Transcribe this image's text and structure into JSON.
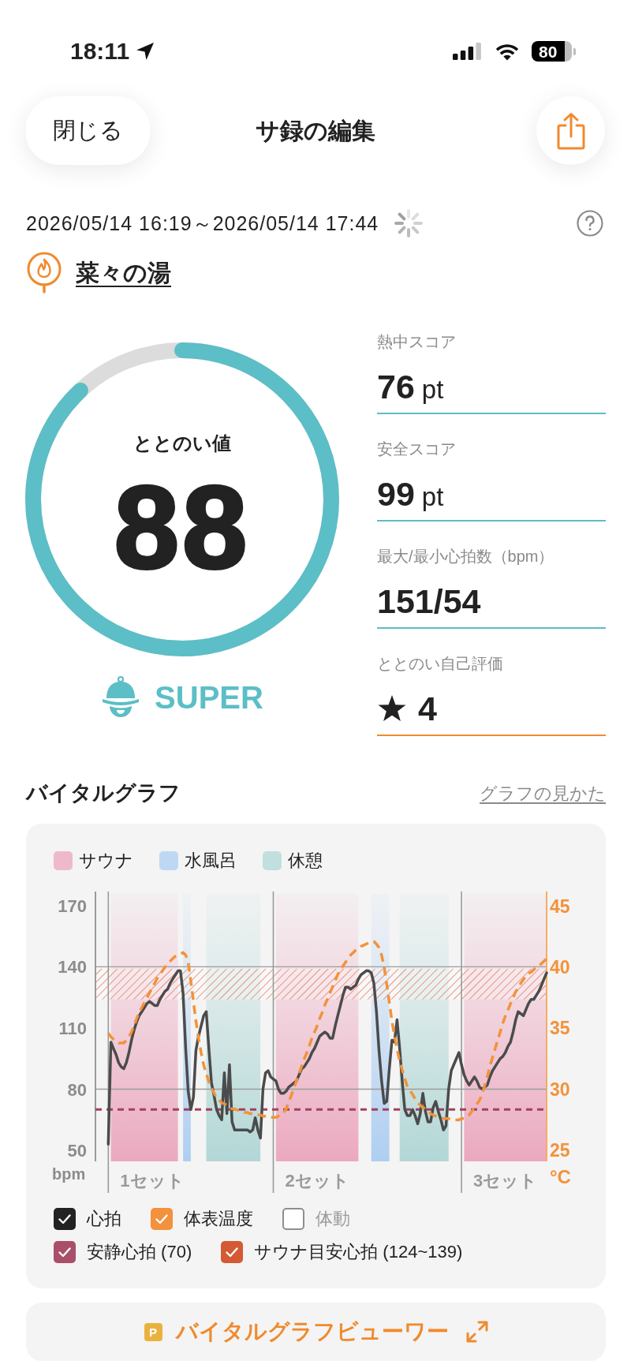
{
  "status_bar": {
    "time": "18:11",
    "battery": "80"
  },
  "header": {
    "close_button": "閉じる",
    "title": "サ録の編集"
  },
  "session": {
    "period": "2026/05/14 16:19～2026/05/14 17:44",
    "loading": true,
    "facility": "菜々の湯"
  },
  "score": {
    "label": "ととのい値",
    "value": "88",
    "level": 0.88,
    "rank": "SUPER"
  },
  "stats": [
    {
      "kind": "number",
      "label": "熱中スコア",
      "value": "76",
      "unit": "pt",
      "color": "#5cbec6"
    },
    {
      "kind": "number",
      "label": "安全スコア",
      "value": "99",
      "unit": "pt",
      "color": "#5cbec6"
    },
    {
      "kind": "number",
      "label": "最大/最小心拍数（bpm）",
      "value": "151/54",
      "color": "#5cbec6"
    },
    {
      "kind": "rating",
      "label": "ととのい自己評価",
      "value": "4",
      "color": "#f08a2e"
    }
  ],
  "vital_graph": {
    "title": "バイタルグラフ",
    "help_link": "グラフの見かた",
    "legend": [
      {
        "label": "サウナ",
        "color": "#efb9cc"
      },
      {
        "label": "水風呂",
        "color": "#bed8f4"
      },
      {
        "label": "休憩",
        "color": "#c1dfde"
      }
    ],
    "chart_data": {
      "type": "line",
      "ylabel": "bpm",
      "y2label": "°C",
      "ylim": [
        44.6,
        176.9
      ],
      "y2lim": [
        24.1,
        46.2
      ],
      "yticks": [
        50,
        80,
        110,
        140,
        170
      ],
      "y2ticks": [
        25,
        30,
        35,
        40,
        45
      ],
      "categories": [
        null,
        null,
        null,
        null,
        null,
        null,
        null,
        null,
        null,
        null,
        null,
        null,
        null,
        null,
        null,
        null,
        null,
        null,
        null,
        null,
        null,
        null,
        null,
        null,
        null,
        null,
        null,
        null,
        null,
        null,
        null,
        null,
        null,
        null,
        null,
        null,
        null,
        null,
        null,
        null,
        null,
        null,
        null,
        null,
        null,
        null,
        null,
        null,
        null,
        null,
        null,
        null,
        null,
        null,
        null,
        null,
        null,
        null,
        null,
        null,
        null,
        null,
        null,
        null,
        null,
        null,
        null,
        null,
        null,
        null,
        null,
        null,
        null,
        null,
        null,
        null,
        null,
        null,
        null,
        null,
        null,
        null,
        null,
        null,
        null,
        null,
        null,
        null,
        null,
        null,
        null,
        null,
        null,
        null,
        null,
        null,
        null,
        null,
        null,
        null,
        null,
        null,
        null,
        null,
        null,
        null,
        null,
        null,
        null,
        null,
        null,
        null,
        null,
        null,
        null,
        null,
        null,
        null,
        null,
        null,
        null,
        null,
        null,
        null,
        null,
        null,
        null,
        null,
        null,
        null,
        null,
        null,
        null,
        null,
        null,
        null,
        null,
        null,
        null,
        null,
        null,
        null,
        null,
        null,
        null,
        null,
        null,
        null,
        null,
        null,
        null,
        null,
        null,
        null,
        null,
        null,
        null,
        null,
        null,
        null,
        null,
        null,
        null,
        null,
        null,
        null,
        null,
        null,
        null,
        null,
        null
      ],
      "series": [
        {
          "color": "#4b4b4b",
          "line_style": "solid",
          "values": [
            53,
            103,
            100,
            97,
            93,
            91,
            90,
            93,
            98,
            104,
            109,
            113,
            116,
            118,
            120,
            122,
            123,
            122,
            121,
            121,
            124,
            126,
            128,
            129,
            132,
            134,
            136,
            138,
            138,
            127,
            100,
            79,
            70,
            76,
            99,
            106,
            111,
            116,
            118,
            100,
            83,
            77,
            70,
            67,
            65,
            88,
            68,
            92,
            64,
            60,
            60,
            60,
            60,
            60,
            60,
            59,
            60,
            66,
            60,
            56,
            80,
            88,
            89,
            86,
            85,
            84,
            80,
            78,
            78,
            79,
            81,
            82,
            83,
            84,
            87,
            90,
            91,
            93,
            95,
            98,
            100,
            103,
            106,
            107,
            108,
            107,
            105,
            105,
            111,
            116,
            121,
            126,
            130,
            130,
            129,
            130,
            131,
            134,
            136,
            137,
            138,
            138,
            137,
            132,
            118,
            99,
            84,
            73,
            74,
            90,
            104,
            103,
            114,
            100,
            84,
            70,
            67,
            67,
            70,
            67,
            63,
            68,
            78,
            69,
            64,
            64,
            71,
            74,
            69,
            65,
            60,
            62,
            80,
            89,
            92,
            95,
            98,
            92,
            87,
            84,
            82,
            84,
            86,
            84,
            81,
            80,
            81,
            82,
            86,
            89,
            91,
            93,
            95,
            96,
            98,
            101,
            103,
            108,
            114,
            118,
            117,
            116,
            119,
            122,
            124,
            124,
            126,
            128,
            131,
            134,
            137
          ]
        },
        {
          "color": "#f3923a",
          "axis": "y2",
          "line_style": "dashed",
          "values": [
            34.6,
            34.3,
            34.1,
            33.9,
            33.8,
            33.8,
            33.8,
            34.0,
            34.3,
            34.7,
            35.2,
            35.8,
            36.3,
            36.7,
            37.1,
            37.5,
            37.9,
            38.3,
            38.7,
            39.1,
            39.4,
            39.7,
            40.0,
            40.3,
            40.5,
            40.7,
            40.9,
            41.0,
            41.1,
            41.2,
            41.0,
            40.4,
            38.9,
            37.2,
            35.6,
            34.2,
            33.0,
            32.0,
            31.3,
            30.6,
            30.1,
            29.7,
            29.3,
            29.1,
            28.9,
            28.8,
            28.7,
            28.5,
            28.4,
            28.4,
            28.3,
            28.3,
            28.2,
            28.1,
            28.1,
            28.0,
            28.0,
            27.9,
            27.9,
            27.9,
            27.8,
            27.8,
            27.8,
            27.7,
            27.7,
            27.7,
            27.8,
            27.9,
            28.1,
            28.4,
            29.0,
            29.5,
            30.1,
            30.7,
            31.3,
            31.9,
            32.5,
            33.0,
            33.6,
            34.2,
            34.7,
            35.2,
            35.8,
            36.3,
            36.9,
            37.4,
            37.9,
            38.4,
            38.9,
            39.4,
            39.8,
            40.1,
            40.4,
            40.7,
            41.0,
            41.2,
            41.4,
            41.5,
            41.7,
            41.8,
            41.9,
            42.0,
            42.1,
            42.1,
            41.9,
            41.6,
            41.0,
            40.0,
            38.6,
            37.1,
            35.6,
            34.4,
            33.3,
            32.3,
            31.6,
            30.9,
            30.2,
            29.9,
            29.6,
            29.2,
            28.9,
            28.7,
            28.5,
            28.4,
            28.2,
            28.0,
            27.9,
            27.8,
            27.7,
            27.6,
            27.6,
            27.6,
            27.6,
            27.5,
            27.5,
            27.5,
            27.5,
            27.6,
            27.6,
            27.7,
            27.9,
            28.2,
            28.5,
            28.8,
            29.1,
            29.6,
            30.3,
            31.0,
            31.9,
            32.6,
            33.3,
            34.0,
            34.7,
            35.4,
            36.0,
            36.5,
            37.0,
            37.5,
            38.0,
            38.3,
            38.7,
            39.0,
            39.3,
            39.5,
            39.6,
            39.8,
            40.0,
            40.1,
            40.3,
            40.5,
            40.7
          ]
        }
      ],
      "bands": [
        {
          "axis": "y",
          "from": 124,
          "to": 139,
          "color": "#e0663f"
        }
      ],
      "ref_lines": [
        {
          "axis": "y",
          "value": 140
        },
        {
          "axis": "y",
          "value": 80
        },
        {
          "axis": "y",
          "value": 70,
          "color": "#a3405f"
        }
      ],
      "annotations": [
        "1セット",
        "2セット",
        "3セット"
      ]
    },
    "toggles": [
      [
        {
          "label": "心拍",
          "checked": true,
          "color": "#222222"
        },
        {
          "label": "体表温度",
          "checked": true,
          "color": "#f3913c"
        },
        {
          "label": "体動",
          "checked": false,
          "color": "#8e8e8e"
        }
      ],
      [
        {
          "label": "安静心拍 (70)",
          "checked": true,
          "color": "#a94f69"
        },
        {
          "label": "サウナ目安心拍 (124~139)",
          "checked": true,
          "color": "#d35a34"
        }
      ]
    ]
  },
  "viewer_button": {
    "badge": "P",
    "label": "バイタルグラフビューワー"
  }
}
